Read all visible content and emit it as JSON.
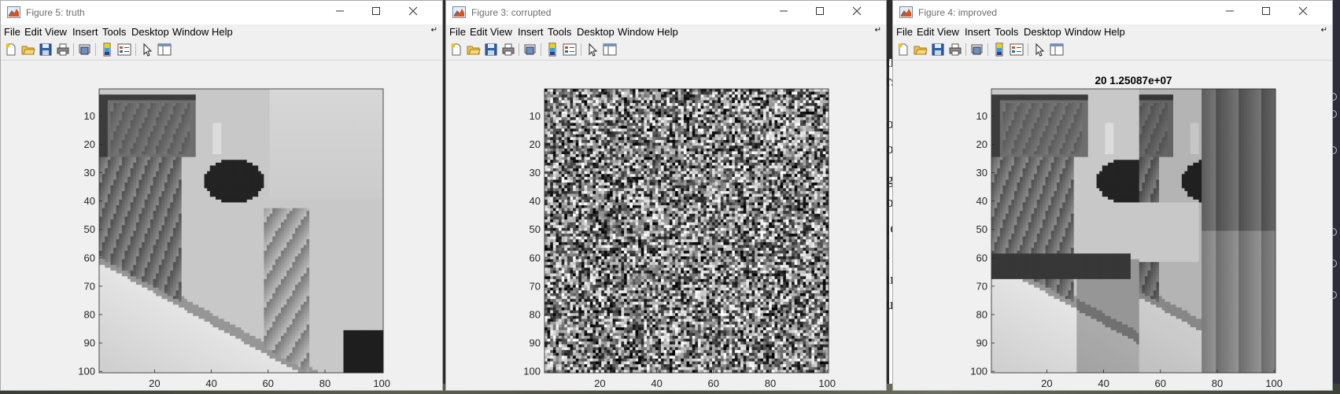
{
  "windows": [
    {
      "id": "truth",
      "title": "Figure 5: truth",
      "plot_title": "",
      "image_kind": "truth"
    },
    {
      "id": "corrupted",
      "title": "Figure 3: corrupted",
      "plot_title": "",
      "image_kind": "noise"
    },
    {
      "id": "improved",
      "title": "Figure 4: improved",
      "plot_title": "20 1.25087e+07",
      "image_kind": "improved"
    }
  ],
  "menu": [
    "File",
    "Edit",
    "View",
    "Insert",
    "Tools",
    "Desktop",
    "Window",
    "Help"
  ],
  "toolbar_icons": [
    "new-figure-icon",
    "open-file-icon",
    "save-icon",
    "print-icon",
    "link-plot-icon",
    "colorbar-icon",
    "legend-icon",
    "edit-plot-icon",
    "property-inspector-icon"
  ],
  "window_controls": [
    "minimize-icon",
    "maximize-icon",
    "close-icon"
  ],
  "axes": {
    "x_ticks": [
      "20",
      "40",
      "60",
      "80",
      "100"
    ],
    "y_ticks": [
      "10",
      "20",
      "30",
      "40",
      "50",
      "60",
      "70",
      "80",
      "90",
      "100"
    ],
    "xlim": [
      0.5,
      100.5
    ],
    "ylim": [
      0.5,
      100.5
    ],
    "y_direction": "reverse",
    "colormap": "gray"
  },
  "background_text": [
    "tl",
    "rs",
    "o",
    "o",
    "g",
    "o",
    "je",
    "i",
    "ir",
    "u"
  ],
  "colors": {
    "titlebar": "#ffffff",
    "window": "#f0f0f0",
    "matlab_orange": "#d95319"
  }
}
